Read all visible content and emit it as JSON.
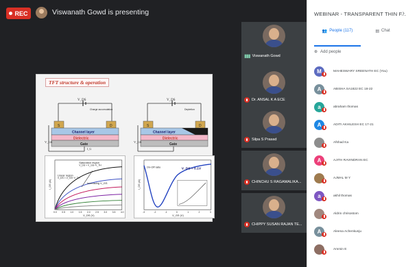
{
  "top_bar": {
    "rec_label": "REC",
    "presenting_text": "Viswanath Gowd is presenting"
  },
  "slide": {
    "title": "TFT structure & operation",
    "left_device": {
      "vds": "V_DS",
      "vgs": "V_GS",
      "charge_label": "Charge accumulation",
      "s": "S",
      "d": "D",
      "channel": "Channel layer",
      "dielectric": "Dielectric",
      "gate": "Gate",
      "ig": "I_G"
    },
    "right_device": {
      "vds": "V_DS",
      "vgs": "V_GS",
      "s": "S",
      "d": "D",
      "depletion": "Depletion",
      "channel": "Channel layer",
      "dielectric": "Dielectric",
      "gate": "Gate"
    },
    "left_graph": {
      "region1": "Saturation region",
      "region1b": "V_DS > V_GS−V_TH",
      "region2": "Linear region",
      "region2b": "V_DS < V_GS−V_TH",
      "arrow": "Increasing V_GS",
      "ylabel": "I_DS (A)",
      "xlabel": "V_DS (V)",
      "xticks": [
        "0.0",
        "0.5",
        "1.0",
        "1.5",
        "2.0",
        "2.5",
        "3.0",
        "3.5",
        "4.0"
      ]
    },
    "right_graph": {
      "onoff": "On-Off ratio",
      "vds": "V_DS = 0.1V",
      "ylabel": "I_DS (A)",
      "xlabel": "V_GS (V)",
      "xticks": [
        "-3",
        "-2",
        "-1",
        "0",
        "1",
        "2",
        "3"
      ]
    }
  },
  "tiles": [
    {
      "name": "Viswanath Gowd",
      "mic": "speaking"
    },
    {
      "name": "Dr. ANSAL K A ECE",
      "mic": "muted"
    },
    {
      "name": "Silpa S Prasad",
      "mic": "muted"
    },
    {
      "name": "CHINCHU S RAGAMALIKA...",
      "mic": "muted"
    },
    {
      "name": "CHIPPY SUSAN RAJAN TE...",
      "mic": "muted"
    }
  ],
  "panel": {
    "title": "WEBINAR - TRANSPARENT THIN F...",
    "close_icon": "chevron-right-icon",
    "tab_people": "People (117)",
    "tab_chat": "Chat",
    "add_people": "Add people",
    "people": [
      {
        "initial": "M",
        "color": "#5c6bc0",
        "name": "MAHESWARY SREENATH EC (You)"
      },
      {
        "initial": "A",
        "color": "#78909c",
        "name": "ABISHA SA1822 EC 18-22"
      },
      {
        "initial": "a",
        "color": "#26a69a",
        "name": "abraham thomas"
      },
      {
        "initial": "A",
        "color": "#1e88e5",
        "name": "ADITI AKHILESH EC 17-21"
      },
      {
        "initial": "",
        "color": "#8d8d8d",
        "name": "Afshad Ka"
      },
      {
        "initial": "A",
        "color": "#ec407a",
        "name": "AJITH RAVINDRAN EC"
      },
      {
        "initial": "",
        "color": "#9e7b4f",
        "name": "AJMAL M Y"
      },
      {
        "initial": "a",
        "color": "#7e57c2",
        "name": "akhil thomas"
      },
      {
        "initial": "",
        "color": "#a1887f",
        "name": "Aldrin chrisostom"
      },
      {
        "initial": "A",
        "color": "#78909c",
        "name": "Aleena Achenkunju"
      },
      {
        "initial": "",
        "color": "#8d6e63",
        "name": "Ammin E"
      }
    ]
  }
}
